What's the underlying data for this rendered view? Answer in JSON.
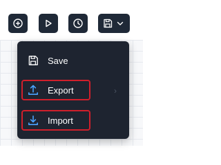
{
  "toolbar": {
    "buttons": [
      {
        "icon": "plus-circle-icon"
      },
      {
        "icon": "play-icon"
      },
      {
        "icon": "clock-icon"
      },
      {
        "icon": "save-icon",
        "dropdown_icon": "chevron-down-icon"
      }
    ]
  },
  "menu": {
    "items": [
      {
        "label": "Save",
        "icon": "save-icon",
        "highlighted": false
      },
      {
        "label": "Export",
        "icon": "export-icon",
        "highlighted": true
      },
      {
        "label": "Import",
        "icon": "import-icon",
        "highlighted": true
      }
    ],
    "submenu_indicator": "›"
  },
  "colors": {
    "toolbar_bg": "#1f2937",
    "menu_bg": "#1e2430",
    "highlight": "#d11f2b",
    "text": "#ffffff",
    "icon_blue": "#4aa3ff"
  }
}
